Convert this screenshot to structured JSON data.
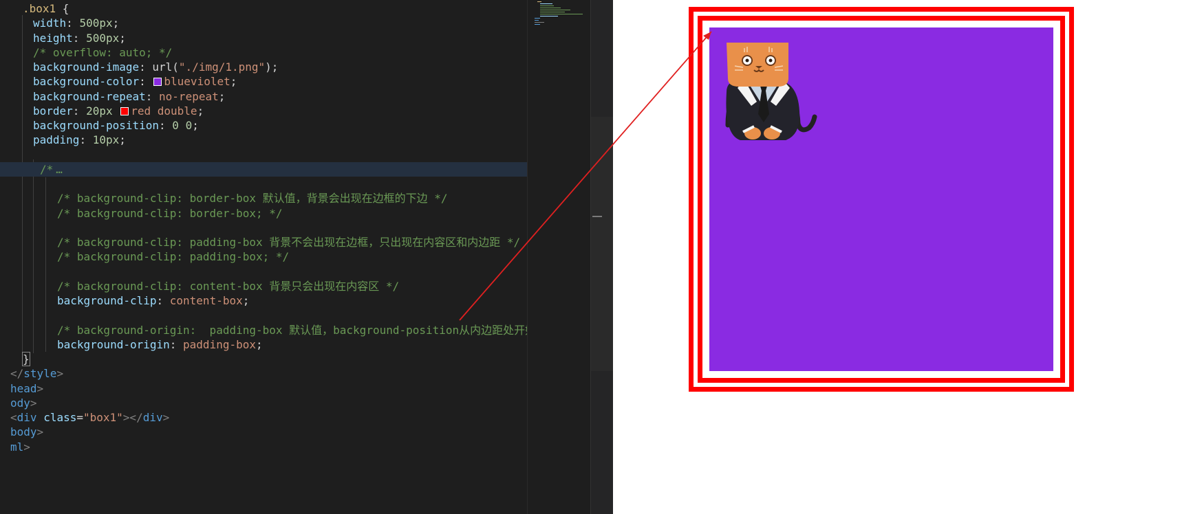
{
  "editor": {
    "lines": [
      {
        "fold": false,
        "tokens": [
          {
            "t": ".box1 ",
            "c": "sel"
          },
          {
            "t": "{",
            "c": "pun"
          }
        ]
      },
      {
        "tokens": [
          {
            "t": "width",
            "c": "prop"
          },
          {
            "t": ": ",
            "c": "pun"
          },
          {
            "t": "500px",
            "c": "num"
          },
          {
            "t": ";",
            "c": "pun"
          }
        ]
      },
      {
        "tokens": [
          {
            "t": "height",
            "c": "prop"
          },
          {
            "t": ": ",
            "c": "pun"
          },
          {
            "t": "500px",
            "c": "num"
          },
          {
            "t": ";",
            "c": "pun"
          }
        ]
      },
      {
        "tokens": [
          {
            "t": "/* overflow: auto; */",
            "c": "com"
          }
        ]
      },
      {
        "tokens": [
          {
            "t": "background-image",
            "c": "prop"
          },
          {
            "t": ": url(",
            "c": "pun"
          },
          {
            "t": "\"./img/1.png\"",
            "c": "str"
          },
          {
            "t": ");",
            "c": "pun"
          }
        ]
      },
      {
        "tokens": [
          {
            "t": "background-color",
            "c": "prop"
          },
          {
            "t": ": ",
            "c": "pun"
          },
          {
            "swatch": "#8a2be2"
          },
          {
            "t": "blueviolet",
            "c": "val"
          },
          {
            "t": ";",
            "c": "pun"
          }
        ]
      },
      {
        "tokens": [
          {
            "t": "background-repeat",
            "c": "prop"
          },
          {
            "t": ": ",
            "c": "pun"
          },
          {
            "t": "no-repeat",
            "c": "val"
          },
          {
            "t": ";",
            "c": "pun"
          }
        ]
      },
      {
        "tokens": [
          {
            "t": "border",
            "c": "prop"
          },
          {
            "t": ": ",
            "c": "pun"
          },
          {
            "t": "20px ",
            "c": "num"
          },
          {
            "swatch": "#ff0000"
          },
          {
            "t": "red double",
            "c": "val"
          },
          {
            "t": ";",
            "c": "pun"
          }
        ]
      },
      {
        "tokens": [
          {
            "t": "background-position",
            "c": "prop"
          },
          {
            "t": ": ",
            "c": "pun"
          },
          {
            "t": "0 0",
            "c": "num"
          },
          {
            "t": ";",
            "c": "pun"
          }
        ]
      },
      {
        "tokens": [
          {
            "t": "padding",
            "c": "prop"
          },
          {
            "t": ": ",
            "c": "pun"
          },
          {
            "t": "10px",
            "c": "num"
          },
          {
            "t": ";",
            "c": "pun"
          }
        ]
      },
      {
        "tokens": []
      },
      {
        "folded": true,
        "tokens": [
          {
            "t": "/*",
            "c": "com"
          }
        ]
      },
      {
        "tokens": []
      },
      {
        "tokens": [
          {
            "t": "/* background-clip: border-box 默认值，背景会出现在边框的下边 */",
            "c": "com"
          }
        ]
      },
      {
        "tokens": [
          {
            "t": "/* background-clip: border-box; */",
            "c": "com"
          }
        ]
      },
      {
        "tokens": []
      },
      {
        "tokens": [
          {
            "t": "/* background-clip: padding-box 背景不会出现在边框，只出现在内容区和内边距 */",
            "c": "com"
          }
        ]
      },
      {
        "tokens": [
          {
            "t": "/* background-clip: padding-box; */",
            "c": "com"
          }
        ]
      },
      {
        "tokens": []
      },
      {
        "tokens": [
          {
            "t": "/* background-clip: content-box 背景只会出现在内容区 */",
            "c": "com"
          }
        ]
      },
      {
        "tokens": [
          {
            "t": "background-clip",
            "c": "prop"
          },
          {
            "t": ": ",
            "c": "pun"
          },
          {
            "t": "content-box",
            "c": "val"
          },
          {
            "t": ";",
            "c": "pun"
          }
        ]
      },
      {
        "tokens": []
      },
      {
        "tokens": [
          {
            "t": "/* background-origin:  padding-box 默认值，background-position从内边距处开始计算",
            "c": "com"
          }
        ]
      },
      {
        "tokens": [
          {
            "t": "background-origin",
            "c": "prop"
          },
          {
            "t": ": ",
            "c": "pun"
          },
          {
            "t": "padding-box",
            "c": "val"
          },
          {
            "t": ";",
            "c": "pun"
          }
        ]
      },
      {
        "tokens": [
          {
            "t": "}",
            "c": "pun",
            "box": true
          }
        ]
      },
      {
        "tokens": [
          {
            "t": "</",
            "c": "dim"
          },
          {
            "t": "style",
            "c": "tag"
          },
          {
            "t": ">",
            "c": "dim"
          }
        ]
      },
      {
        "tokens": [
          {
            "t": "head",
            "c": "tag"
          },
          {
            "t": ">",
            "c": "dim"
          }
        ]
      },
      {
        "tokens": [
          {
            "t": "ody",
            "c": "tag"
          },
          {
            "t": ">",
            "c": "dim"
          }
        ]
      },
      {
        "tokens": [
          {
            "t": "<",
            "c": "dim"
          },
          {
            "t": "div",
            "c": "tag"
          },
          {
            "t": " ",
            "c": "pun"
          },
          {
            "t": "class",
            "c": "attr"
          },
          {
            "t": "=",
            "c": "pun"
          },
          {
            "t": "\"box1\"",
            "c": "str"
          },
          {
            "t": "></",
            "c": "dim"
          },
          {
            "t": "div",
            "c": "tag"
          },
          {
            "t": ">",
            "c": "dim"
          }
        ]
      },
      {
        "tokens": [
          {
            "t": "body",
            "c": "tag"
          },
          {
            "t": ">",
            "c": "dim"
          }
        ]
      },
      {
        "tokens": [
          {
            "t": "ml",
            "c": "tag"
          },
          {
            "t": ">",
            "c": "dim"
          }
        ]
      }
    ],
    "folded_placeholder": "…"
  },
  "colors": {
    "box_background": "#8a2be2",
    "box_border": "#ff0000",
    "annotation_arrow": "#e02020"
  },
  "preview": {
    "element": "div.box1",
    "background_image_alt": "cat-in-suit-illustration"
  }
}
